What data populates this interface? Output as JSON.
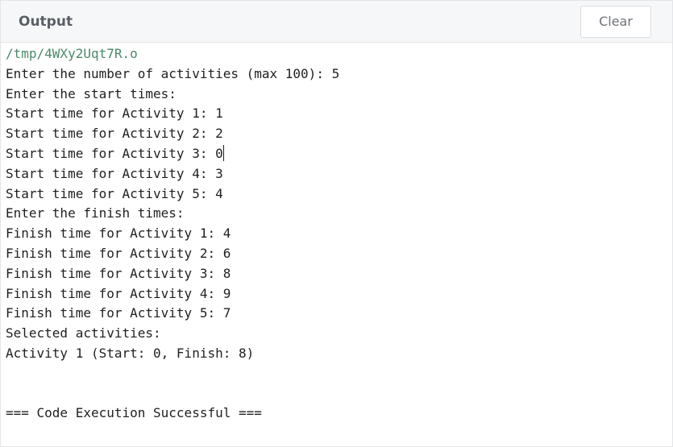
{
  "header": {
    "title": "Output",
    "clear_label": "Clear"
  },
  "console": {
    "path": "/tmp/4WXy2Uqt7R.o",
    "lines_before_caret": [
      "Enter the number of activities (max 100): 5",
      "Enter the start times:",
      "Start time for Activity 1: 1",
      "Start time for Activity 2: 2"
    ],
    "caret_line": "Start time for Activity 3: 0",
    "lines_after_caret": [
      "Start time for Activity 4: 3",
      "Start time for Activity 5: 4",
      "Enter the finish times:",
      "Finish time for Activity 1: 4",
      "Finish time for Activity 2: 6",
      "Finish time for Activity 3: 8",
      "Finish time for Activity 4: 9",
      "Finish time for Activity 5: 7",
      "Selected activities:",
      "Activity 1 (Start: 0, Finish: 8)"
    ],
    "success_message": "=== Code Execution Successful ==="
  },
  "colors": {
    "path_text": "#4a8a6a",
    "console_text": "#1f1f1f",
    "header_bg": "#f6f7f8"
  }
}
